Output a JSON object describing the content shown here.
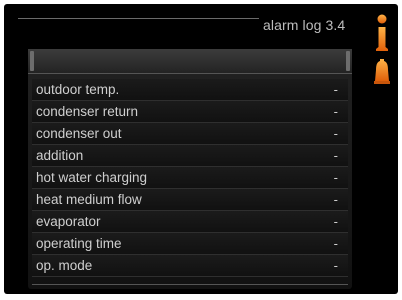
{
  "header": {
    "title": "alarm log 3.4"
  },
  "icons": {
    "top": "info-exclamation-icon",
    "bottom": "alarm-bell-icon",
    "color": "#f07d13"
  },
  "alarm_log": {
    "rows": [
      {
        "label": "outdoor temp.",
        "value": "-"
      },
      {
        "label": "condenser return",
        "value": "-"
      },
      {
        "label": "condenser out",
        "value": "-"
      },
      {
        "label": "addition",
        "value": "-"
      },
      {
        "label": "hot water charging",
        "value": "-"
      },
      {
        "label": "heat medium flow",
        "value": "-"
      },
      {
        "label": "evaporator",
        "value": "-"
      },
      {
        "label": "operating time",
        "value": "-"
      },
      {
        "label": "op. mode",
        "value": "-"
      }
    ]
  }
}
